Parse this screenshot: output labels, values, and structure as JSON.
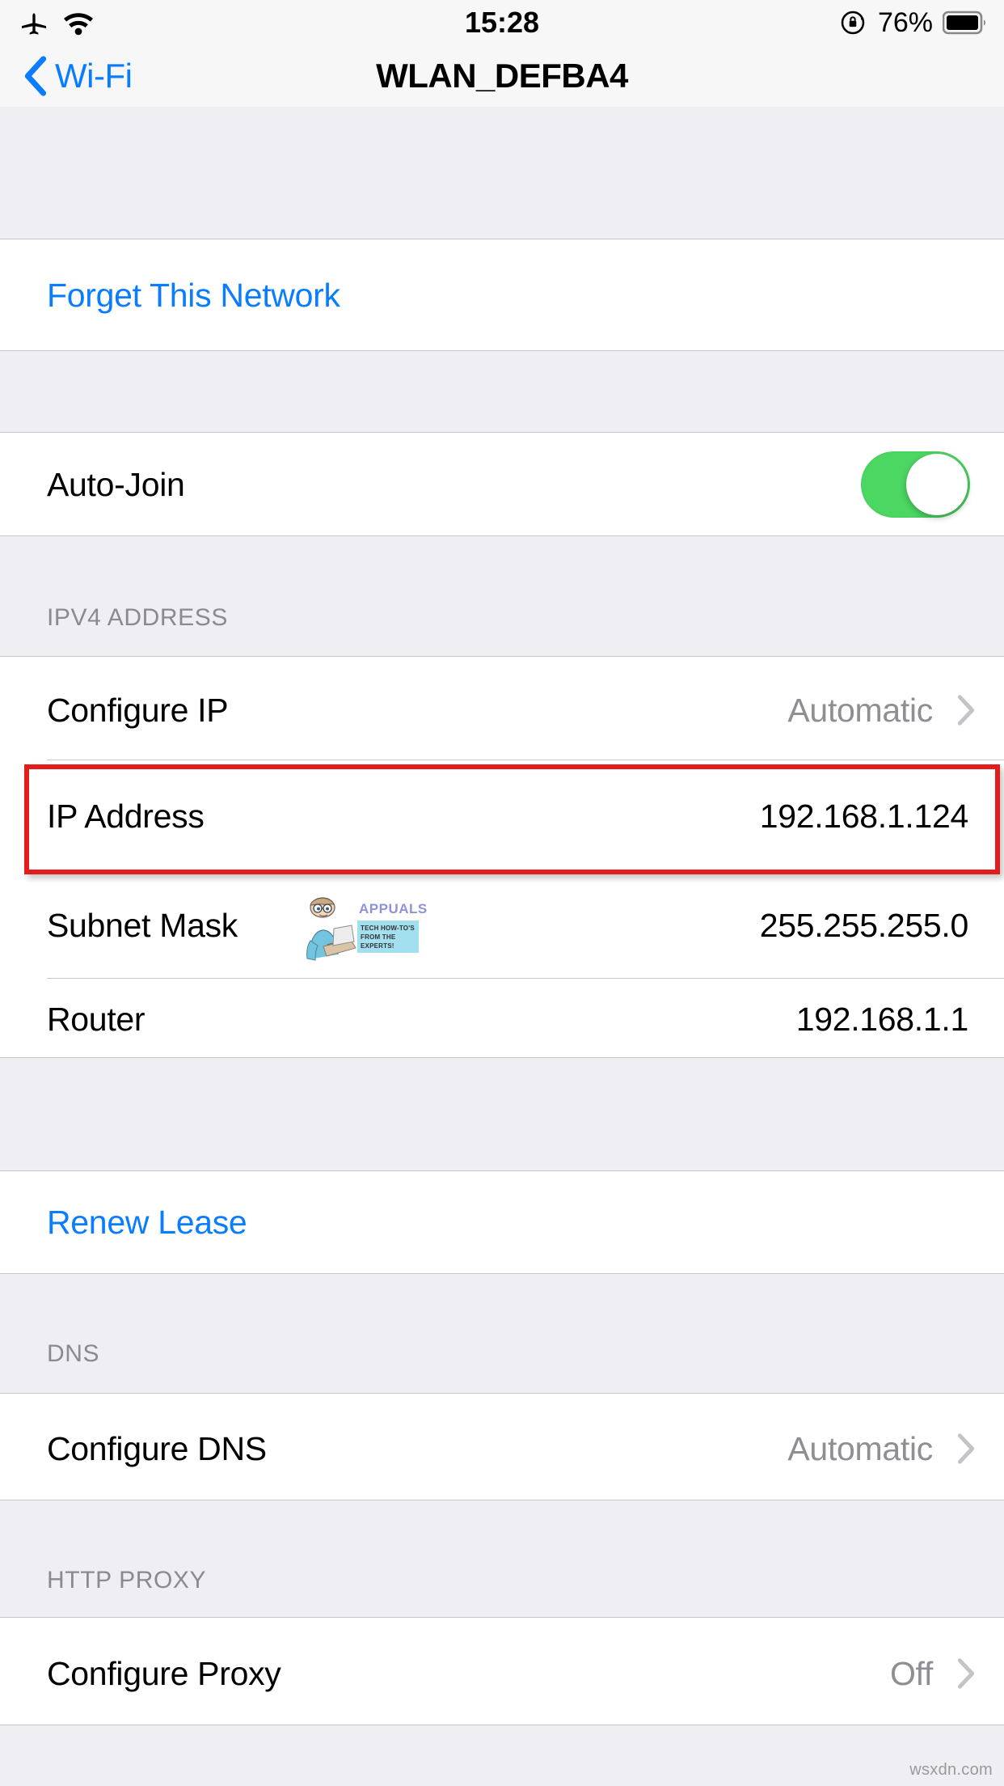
{
  "status_bar": {
    "airplane_icon": "airplane-icon",
    "wifi_icon": "wifi-icon",
    "time": "15:28",
    "rotation_lock_icon": "rotation-lock-icon",
    "battery_percent": "76%",
    "battery_icon": "battery-icon"
  },
  "nav": {
    "back_label": "Wi-Fi",
    "back_icon": "chevron-left-icon",
    "title": "WLAN_DEFBA4"
  },
  "sections": {
    "forget": {
      "action_label": "Forget This Network"
    },
    "autojoin": {
      "label": "Auto-Join",
      "toggle_state": "on"
    },
    "ipv4": {
      "header": "IPV4 ADDRESS",
      "rows": [
        {
          "label": "Configure IP",
          "value": "Automatic",
          "chevron": true
        },
        {
          "label": "IP Address",
          "value": "192.168.1.124",
          "chevron": false
        },
        {
          "label": "Subnet Mask",
          "value": "255.255.255.0",
          "chevron": false
        },
        {
          "label": "Router",
          "value": "192.168.1.1",
          "chevron": false
        }
      ]
    },
    "renew": {
      "action_label": "Renew Lease"
    },
    "dns": {
      "header": "DNS",
      "rows": [
        {
          "label": "Configure DNS",
          "value": "Automatic",
          "chevron": true
        }
      ]
    },
    "proxy": {
      "header": "HTTP PROXY",
      "rows": [
        {
          "label": "Configure Proxy",
          "value": "Off",
          "chevron": true
        }
      ]
    }
  },
  "annotation": {
    "highlight_color": "#E31C1C",
    "highlighted_row": "IP Address"
  },
  "watermark": {
    "brand": "APPUALS",
    "tagline": "TECH HOW-TO'S FROM THE EXPERTS!"
  },
  "footer": {
    "credit": "wsxdn.com"
  },
  "colors": {
    "ios_blue": "#0A7CFF",
    "toggle_green": "#4CD662",
    "group_bg": "#EFEEF3",
    "row_bg": "#FFFFFF",
    "hairline": "#C8C7CC",
    "header_gray": "#8A8A8F"
  }
}
